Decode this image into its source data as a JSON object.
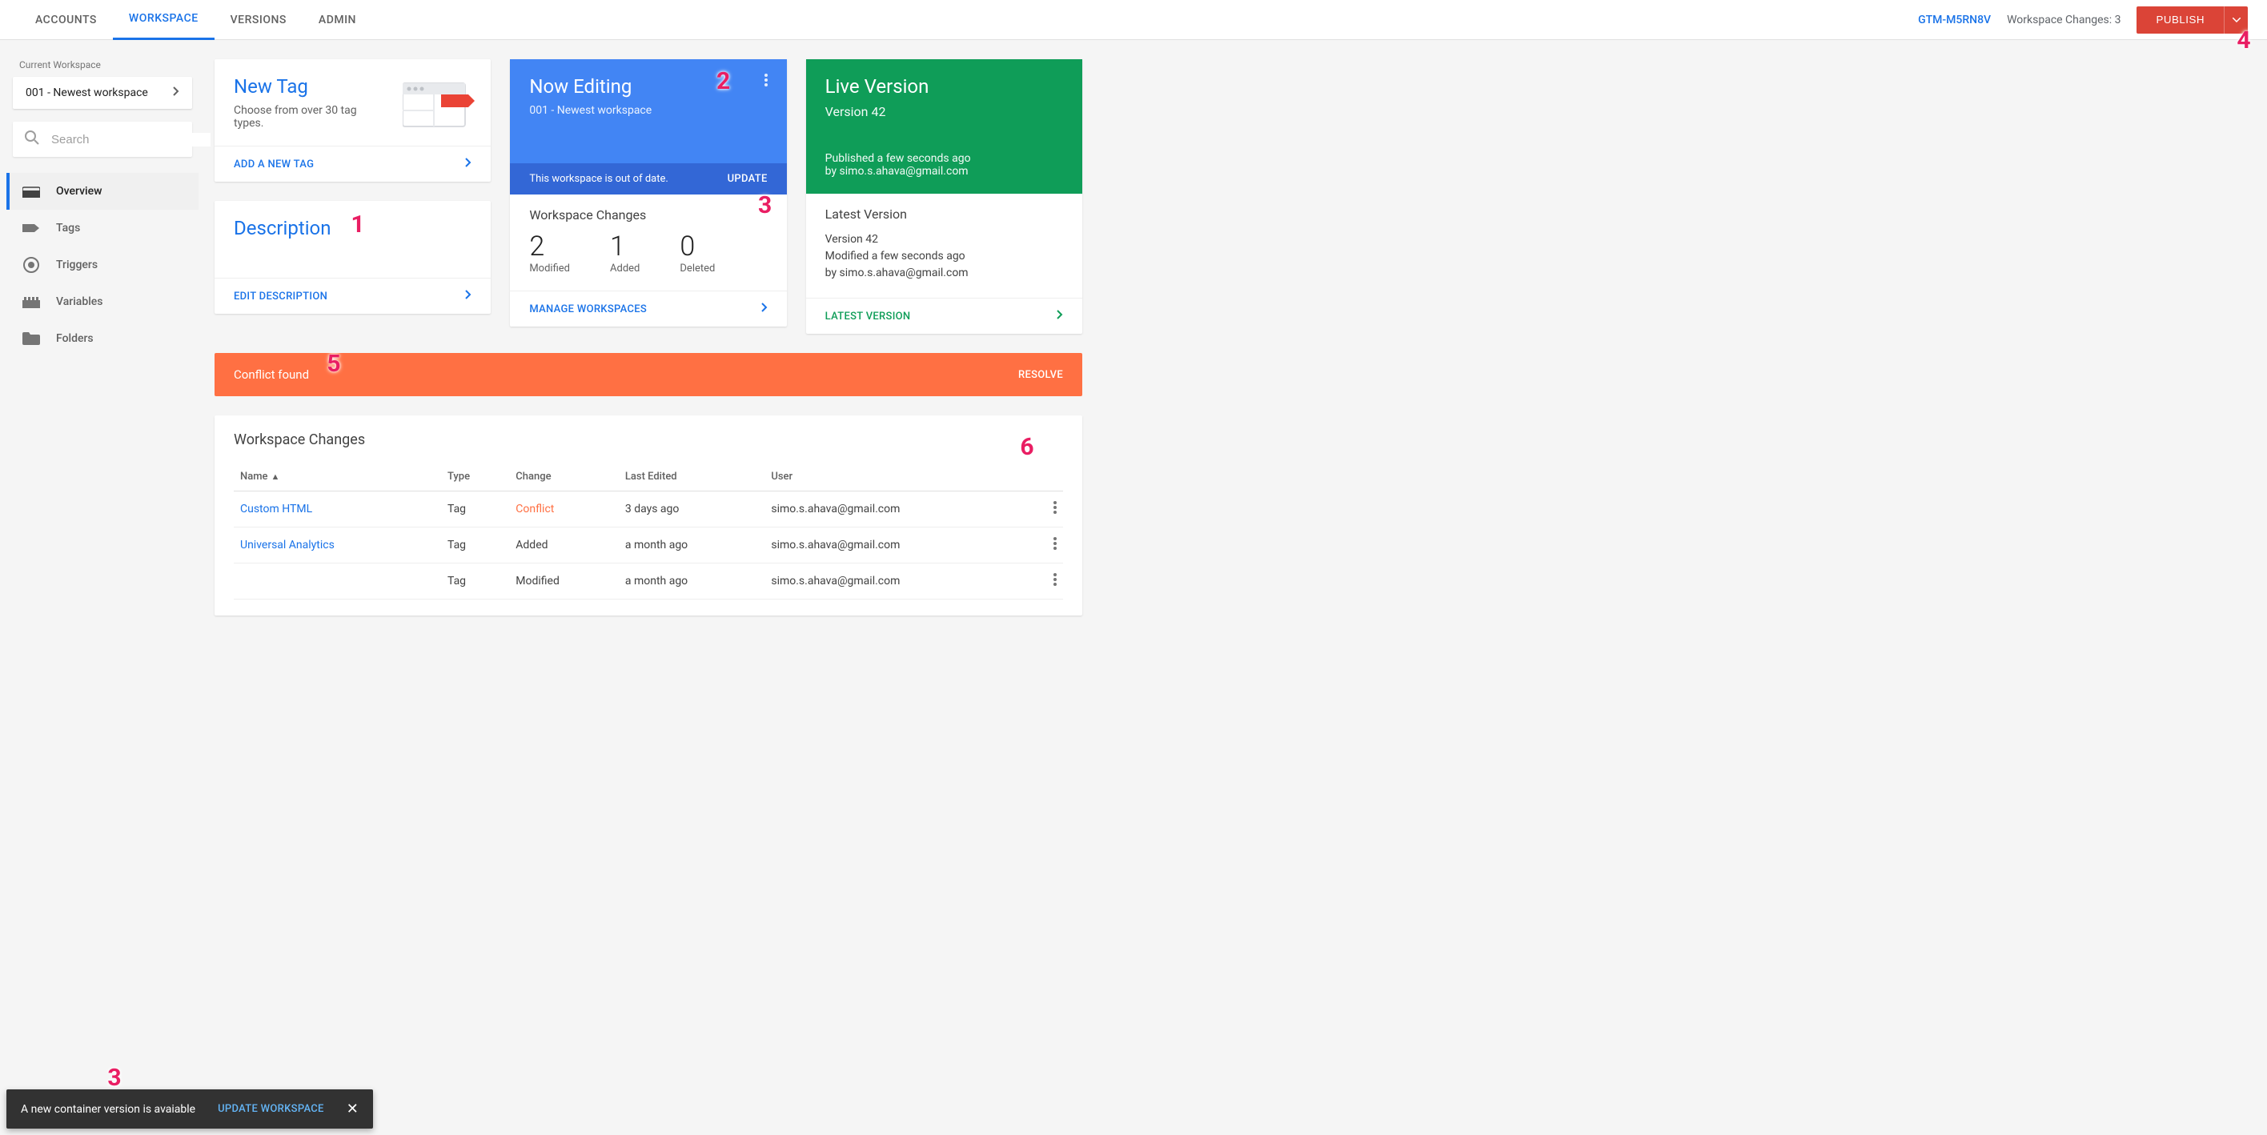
{
  "topnav": {
    "accounts": "ACCOUNTS",
    "workspace": "WORKSPACE",
    "versions": "VERSIONS",
    "admin": "ADMIN"
  },
  "topbar": {
    "container_id": "GTM-M5RN8V",
    "workspace_changes_label": "Workspace Changes: 3",
    "publish": "PUBLISH"
  },
  "sidebar": {
    "current_label": "Current Workspace",
    "current_workspace": "001 - Newest workspace",
    "search_placeholder": "Search",
    "items": {
      "overview": "Overview",
      "tags": "Tags",
      "triggers": "Triggers",
      "variables": "Variables",
      "folders": "Folders"
    }
  },
  "cards": {
    "newtag": {
      "title": "New Tag",
      "sub": "Choose from over 30 tag types.",
      "action": "ADD A NEW TAG"
    },
    "description": {
      "title": "Description",
      "action": "EDIT DESCRIPTION"
    },
    "nowediting": {
      "title": "Now Editing",
      "sub": "001 - Newest workspace",
      "strip_msg": "This workspace is out of date.",
      "strip_action": "UPDATE",
      "changes_heading": "Workspace Changes",
      "modified_n": "2",
      "modified_l": "Modified",
      "added_n": "1",
      "added_l": "Added",
      "deleted_n": "0",
      "deleted_l": "Deleted",
      "action": "MANAGE WORKSPACES"
    },
    "live": {
      "title": "Live Version",
      "sub": "Version 42",
      "pub1": "Published a few seconds ago",
      "pub2": "by simo.s.ahava@gmail.com",
      "latest_heading": "Latest Version",
      "lv1": "Version 42",
      "lv2": "Modified a few seconds ago",
      "lv3": "by simo.s.ahava@gmail.com",
      "action": "LATEST VERSION"
    }
  },
  "conflict": {
    "msg": "Conflict found",
    "action": "RESOLVE"
  },
  "table": {
    "title": "Workspace Changes",
    "cols": {
      "name": "Name",
      "type": "Type",
      "change": "Change",
      "last_edited": "Last Edited",
      "user": "User"
    },
    "rows": [
      {
        "name": "Custom HTML",
        "type": "Tag",
        "change": "Conflict",
        "last_edited": "3 days ago",
        "user": "simo.s.ahava@gmail.com",
        "conflict": true
      },
      {
        "name": "Universal Analytics",
        "type": "Tag",
        "change": "Added",
        "last_edited": "a month ago",
        "user": "simo.s.ahava@gmail.com",
        "conflict": false
      },
      {
        "name": "",
        "type": "Tag",
        "change": "Modified",
        "last_edited": "a month ago",
        "user": "simo.s.ahava@gmail.com",
        "conflict": false
      }
    ]
  },
  "toast": {
    "msg": "A new container version is avaiable",
    "action": "UPDATE WORKSPACE"
  },
  "annotations": {
    "a1": "1",
    "a2": "2",
    "a3": "3",
    "a3b": "3",
    "a4": "4",
    "a5": "5",
    "a6": "6"
  }
}
